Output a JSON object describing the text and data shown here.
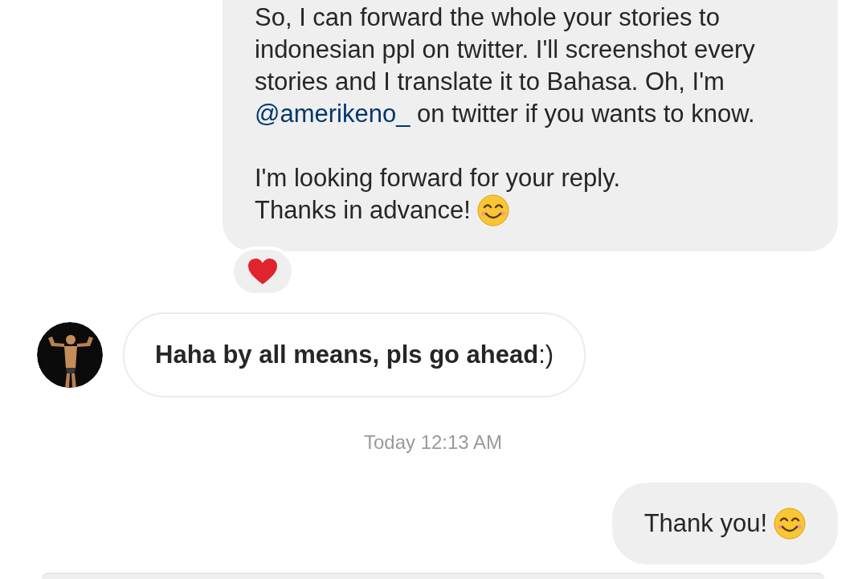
{
  "messages": [
    {
      "kind": "outgoing",
      "paragraphs": [
        {
          "before": "So, I can forward the whole your stories to indonesian ppl on twitter. I'll screenshot every stories and I translate it to Bahasa. Oh, I'm ",
          "link": "@amerikeno_",
          "after": " on twitter if you wants to know."
        },
        {
          "before": "I'm looking forward for your reply.\nThanks in advance!"
        }
      ],
      "emoji": true,
      "reaction": true,
      "cut_top": true
    },
    {
      "kind": "incoming",
      "text": "**Haha by all means, pls go ahead**:)",
      "avatar": true
    },
    {
      "kind": "timestamp",
      "text": "Today 12:13 AM"
    },
    {
      "kind": "outgoing",
      "paragraphs": [
        {
          "before": "Thank you!"
        }
      ],
      "emoji": true,
      "reaction": false,
      "cut_top": false
    },
    {
      "kind": "cutoff"
    }
  ]
}
